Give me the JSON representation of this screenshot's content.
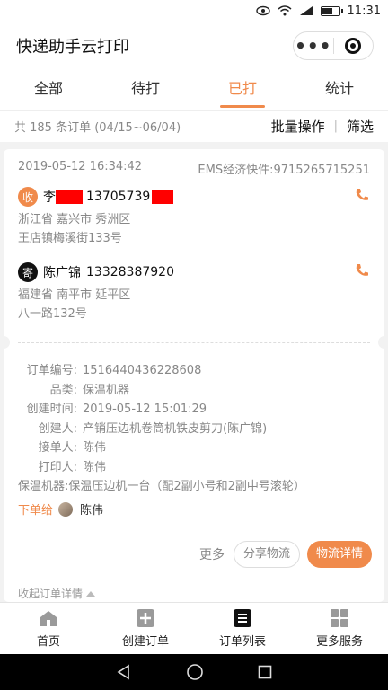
{
  "status": {
    "time": "11:31",
    "battery_level": 0.55
  },
  "app": {
    "title": "快递助手云打印",
    "capsule_more": "•••"
  },
  "tabs": [
    {
      "label": "全部",
      "active": false
    },
    {
      "label": "待打",
      "active": false
    },
    {
      "label": "已打",
      "active": true
    },
    {
      "label": "统计",
      "active": false
    }
  ],
  "summary": {
    "count": "共 185 条订单 (04/15~06/04)",
    "batch": "批量操作",
    "filter": "筛选"
  },
  "order": {
    "datetime": "2019-05-12 16:34:42",
    "express": "EMS经济快件:9715265715251",
    "receiver": {
      "badge": "收",
      "name": "李",
      "phone": "13705739",
      "addr1": "浙江省 嘉兴市 秀洲区",
      "addr2": "王店镇梅溪街133号"
    },
    "sender": {
      "badge": "寄",
      "name": "陈广锦",
      "phone": "13328387920",
      "addr1": "福建省 南平市 延平区",
      "addr2": "八一路132号"
    },
    "info": {
      "order_no_label": "订单编号:",
      "order_no": "1516440436228608",
      "category_label": "品类:",
      "category": "保温机器",
      "created_label": "创建时间:",
      "created": "2019-05-12 15:01:29",
      "creator_label": "创建人:",
      "creator": "产销压边机卷筒机铁皮剪刀(陈广锦)",
      "taker_label": "接单人:",
      "taker": "陈伟",
      "printer_label": "打印人:",
      "printer": "陈伟",
      "note": "保温机器:保温压边机一台（配2副小号和2副中号滚轮）"
    },
    "assign_label": "下单给",
    "assign_to": "陈伟",
    "more": "更多",
    "share": "分享物流",
    "detail": "物流详情",
    "collapse": "收起订单详情"
  },
  "bottom_nav": [
    {
      "label": "首页",
      "icon": "home-icon"
    },
    {
      "label": "创建订单",
      "icon": "add-order-icon"
    },
    {
      "label": "订单列表",
      "icon": "order-list-icon"
    },
    {
      "label": "更多服务",
      "icon": "more-services-icon"
    }
  ],
  "colors": {
    "accent": "#f08a4b",
    "redaction": "#ff0000"
  }
}
